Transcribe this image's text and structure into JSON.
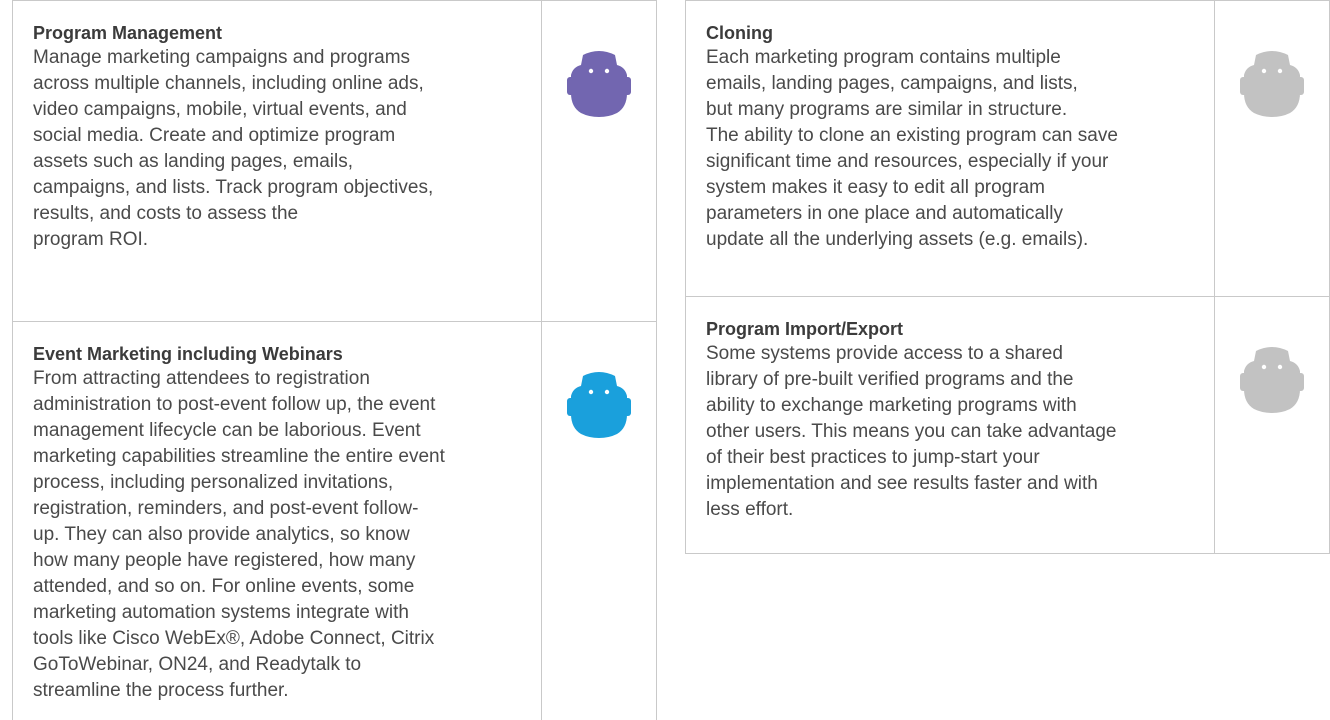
{
  "left": [
    {
      "title": "Program Management",
      "body": "Manage marketing campaigns and programs\nacross multiple channels, including online ads,\nvideo campaigns, mobile, virtual events, and\nsocial media. Create and optimize program\nassets such as landing pages, emails,\ncampaigns, and lists. Track program objectives,\nresults, and costs to assess the\nprogram ROI.",
      "icon": "robot-mascot-icon",
      "icon_color": "#7266b0"
    },
    {
      "title": "Event Marketing including Webinars",
      "body": "From attracting attendees to registration\nadministration to post-event follow up, the event\nmanagement lifecycle can be laborious. Event\nmarketing capabilities streamline the entire event\nprocess, including personalized invitations,\nregistration, reminders, and post-event follow-\nup. They can also provide analytics, so know\nhow many people have registered, how many\nattended, and so on. For online events, some\nmarketing automation systems integrate with\ntools like Cisco WebEx®, Adobe Connect, Citrix\nGoToWebinar, ON24, and Readytalk to\nstreamline the process further.",
      "icon": "robot-mascot-icon",
      "icon_color": "#1aa0dc"
    }
  ],
  "right": [
    {
      "title": "Cloning",
      "body": "Each marketing program contains multiple\nemails, landing pages, campaigns, and lists,\nbut many programs are similar in structure.\nThe ability to clone an existing program can save\nsignificant time and resources, especially if your\nsystem makes it easy to edit all program\nparameters in one place and automatically\nupdate all the underlying assets (e.g. emails).",
      "icon": "robot-mascot-icon",
      "icon_color": "#c2c2c2"
    },
    {
      "title": "Program Import/Export",
      "body": "Some systems provide access to a shared\nlibrary of pre-built verified programs and the\nability to exchange marketing programs with\nother users. This means you can take advantage\nof their best practices to jump-start your\nimplementation and see results faster and with\nless effort.",
      "icon": "robot-mascot-icon",
      "icon_color": "#c2c2c2"
    }
  ]
}
